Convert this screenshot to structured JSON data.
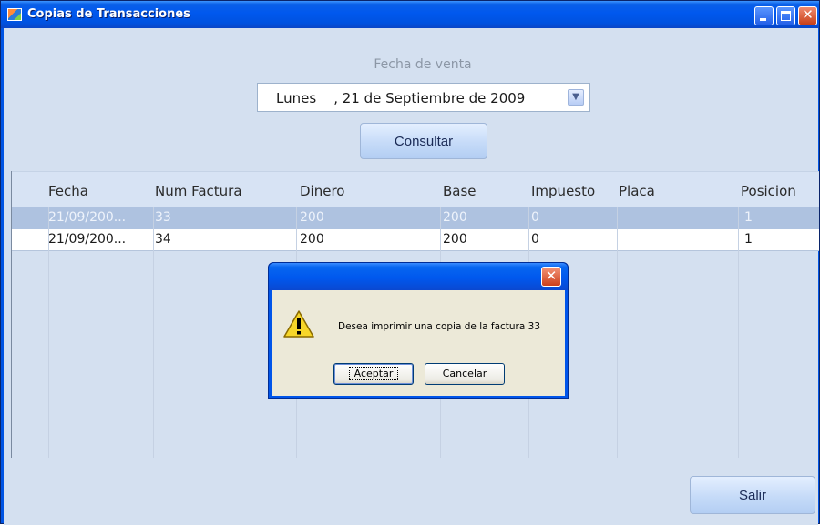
{
  "window": {
    "title": "Copias de Transacciones",
    "close_glyph": "✕"
  },
  "filter": {
    "date_label": "Fecha de venta",
    "date_value": "Lunes    , 21 de Septiembre de 2009",
    "dropdown_glyph": "▼",
    "consultar_label": "Consultar"
  },
  "grid": {
    "columns": [
      "Fecha",
      "Num Factura",
      "Dinero",
      "Base",
      "Impuesto",
      "Placa",
      "Posicion"
    ],
    "rows": [
      [
        "21/09/200...",
        "33",
        "200",
        "200",
        "0",
        "",
        "1"
      ],
      [
        "21/09/200...",
        "34",
        "200",
        "200",
        "0",
        "",
        "1"
      ]
    ],
    "selected_row": 0
  },
  "footer": {
    "salir_label": "Salir"
  },
  "dialog": {
    "message": "Desea imprimir una copia de la factura 33",
    "ok_label": "Aceptar",
    "cancel_label": "Cancelar",
    "close_glyph": "✕",
    "icon": "warning-icon"
  },
  "colors": {
    "titlebar": "#0058ee",
    "client_bg": "#d4e0f0",
    "selected_row": "#aec2e0"
  }
}
